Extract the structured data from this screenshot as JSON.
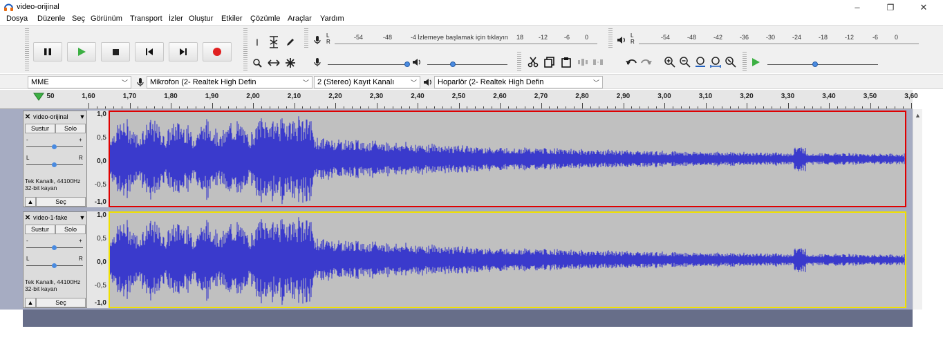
{
  "window": {
    "title": "video-orijinal",
    "minimize_glyph": "–",
    "restore_glyph": "❐",
    "close_glyph": "✕"
  },
  "menu": [
    "Dosya",
    "Düzenle",
    "Seç",
    "Görünüm",
    "Transport",
    "İzler",
    "Oluştur",
    "Etkiler",
    "Çözümle",
    "Araçlar",
    "Yardım"
  ],
  "toolbar": {
    "record_meter_prompt": "İzlemeye başlamak için tıklayın",
    "record_meter_scale": [
      "-54",
      "-48",
      "-4",
      "18",
      "-12",
      "-6",
      "0"
    ],
    "play_meter_scale": [
      "-54",
      "-48",
      "-42",
      "-36",
      "-30",
      "-24",
      "-18",
      "-12",
      "-6",
      "0"
    ],
    "lr_label": [
      "L",
      "R"
    ],
    "slider_plus": "+",
    "slider_minus": "-"
  },
  "devices": {
    "host": "MME",
    "recording_device": "Mikrofon (2- Realtek High Defin",
    "channels": "2 (Stereo) Kayıt Kanalı",
    "playback_device": "Hoparlör (2- Realtek High Defin"
  },
  "timeline": {
    "start_label": "50",
    "labels": [
      "1,60",
      "1,70",
      "1,80",
      "1,90",
      "2,00",
      "2,10",
      "2,20",
      "2,30",
      "2,40",
      "2,50",
      "2,60",
      "2,70",
      "2,80",
      "2,90",
      "3,00",
      "3,10",
      "3,20",
      "3,30",
      "3,40",
      "3,50",
      "3,60"
    ]
  },
  "tracks": [
    {
      "name": "video-orijinal",
      "mute_label": "Sustur",
      "solo_label": "Solo",
      "gain_minus": "-",
      "gain_plus": "+",
      "pan_left": "L",
      "pan_right": "R",
      "info_line1": "Tek Kanallı, 44100Hz",
      "info_line2": "32-bit kayan",
      "select_label": "Seç",
      "scale": [
        "1,0",
        "0,5",
        "0,0",
        "-0,5",
        "-1,0"
      ],
      "border_color": "#e00000"
    },
    {
      "name": "video-1-fake",
      "mute_label": "Sustur",
      "solo_label": "Solo",
      "gain_minus": "-",
      "gain_plus": "+",
      "pan_left": "L",
      "pan_right": "R",
      "info_line1": "Tek Kanallı, 44100Hz",
      "info_line2": "32-bit kayan",
      "select_label": "Seç",
      "scale": [
        "1,0",
        "0,5",
        "0,0",
        "-0,5",
        "-1,0"
      ],
      "border_color": "#f0e000"
    }
  ],
  "colors": {
    "waveform": "#3a3acc",
    "waveform_bg": "#c0c0c0",
    "track_area_bg": "#a6acc2",
    "record_button": "#e02020",
    "play_button": "#3cb043"
  }
}
